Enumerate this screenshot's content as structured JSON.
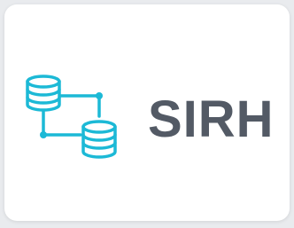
{
  "app": {
    "name": "SIRH",
    "logo_icon": "database-network-icon"
  },
  "colors": {
    "accent": "#1cb9d6",
    "title": "#535a65",
    "card_background": "#ffffff",
    "page_background": "#e9ebee"
  }
}
